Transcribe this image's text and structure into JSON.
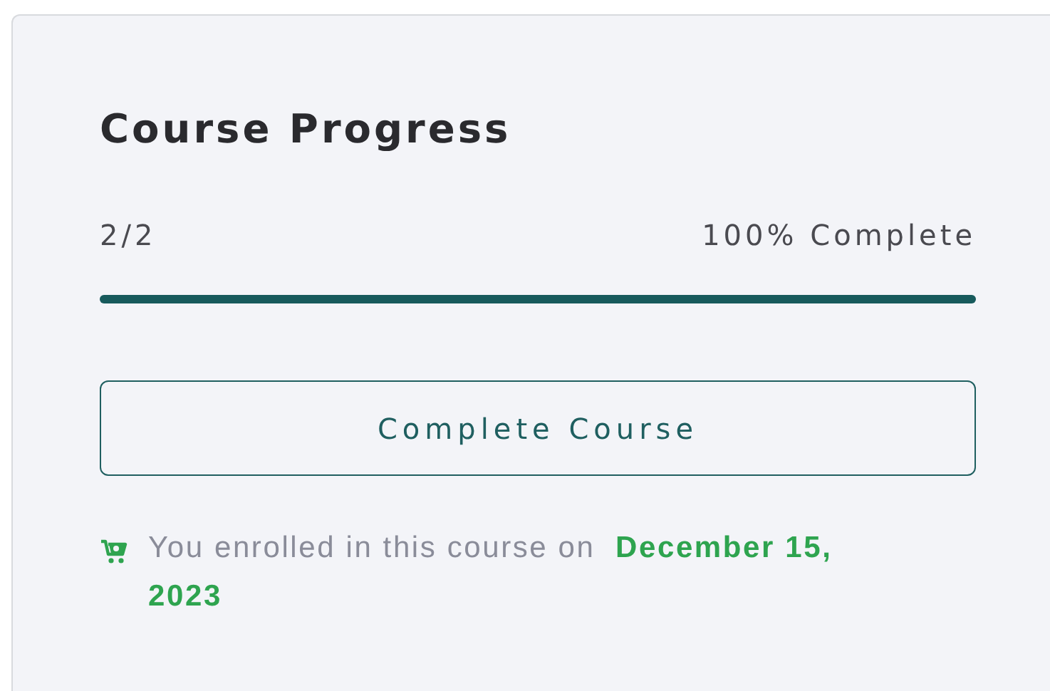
{
  "card": {
    "title": "Course Progress",
    "progress": {
      "count": "2/2",
      "reading": "100% Complete",
      "level": 1
    },
    "button": "Complete Course",
    "enrollment": "You enrolled in this course on  **December 15, 2023**"
  }
}
